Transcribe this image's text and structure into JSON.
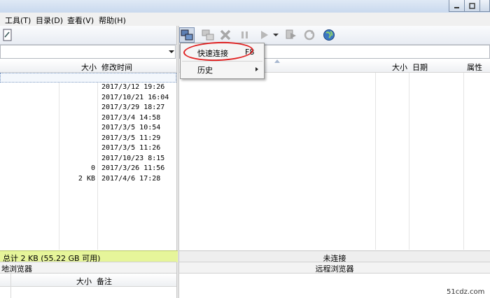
{
  "menu": {
    "tools": "工具(T)",
    "directory": "目录(D)",
    "view": "查看(V)",
    "help": "帮助(H)"
  },
  "local": {
    "headers": {
      "size": "大小",
      "modified": "修改时间"
    },
    "rows": [
      {
        "size": "",
        "modified": "2017/3/12 19:26"
      },
      {
        "size": "",
        "modified": "2017/10/21 16:04"
      },
      {
        "size": "",
        "modified": "2017/3/29 18:27"
      },
      {
        "size": "",
        "modified": "2017/3/4 14:58"
      },
      {
        "size": "",
        "modified": "2017/3/5 10:54"
      },
      {
        "size": "",
        "modified": "2017/3/5 11:29"
      },
      {
        "size": "",
        "modified": "2017/3/5 11:26"
      },
      {
        "size": "",
        "modified": "2017/10/23 8:15"
      },
      {
        "size": "0",
        "modified": "2017/3/26 11:56"
      },
      {
        "size": "2 KB",
        "modified": "2017/4/6 17:28"
      }
    ],
    "status": "总计 2 KB (55.22 GB 可用)",
    "panel_label": "地浏览器"
  },
  "remote": {
    "headers": {
      "size": "大小",
      "date": "日期",
      "attr": "属性"
    },
    "status": "未连接",
    "panel_label": "远程浏览器"
  },
  "queue": {
    "headers": {
      "size": "大小",
      "note": "备注"
    }
  },
  "dropdown": {
    "quick_connect": "快速连接",
    "quick_connect_shortcut": "F8",
    "history": "历史"
  },
  "watermark": "51cdz.com",
  "colors": {
    "highlight_oval": "#e02020",
    "local_status_bg": "#e6f59a"
  }
}
